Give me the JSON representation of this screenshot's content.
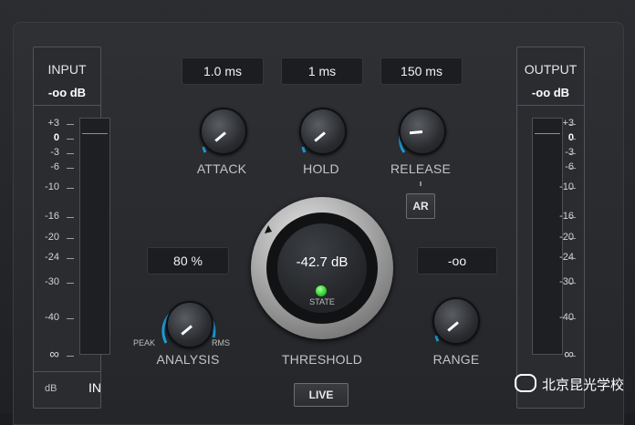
{
  "input_meter": {
    "title": "INPUT",
    "value": "-oo dB",
    "unit": "dB",
    "button": "IN",
    "scale": [
      "+3",
      "0",
      "-3",
      "-6",
      "-10",
      "-16",
      "-20",
      "-24",
      "-30",
      "-40",
      "∞"
    ]
  },
  "output_meter": {
    "title": "OUTPUT",
    "value": "-oo dB",
    "scale": [
      "+3",
      "0",
      "-3",
      "-6",
      "-10",
      "-16",
      "-20",
      "-24",
      "-30",
      "-40",
      "∞"
    ]
  },
  "attack": {
    "value": "1.0 ms",
    "label": "ATTACK"
  },
  "hold": {
    "value": "1 ms",
    "label": "HOLD"
  },
  "release": {
    "value": "150 ms",
    "label": "RELEASE",
    "ar_button": "AR"
  },
  "analysis": {
    "value": "80 %",
    "label": "ANALYSIS",
    "min_label": "PEAK",
    "max_label": "RMS"
  },
  "threshold": {
    "value": "-42.7 dB",
    "label": "THRESHOLD",
    "state_label": "STATE"
  },
  "range": {
    "value": "-oo",
    "label": "RANGE"
  },
  "live_button": "LIVE",
  "watermark": "北京昆光学校",
  "colors": {
    "accent": "#1e9bd7",
    "led": "#2bd12b"
  }
}
